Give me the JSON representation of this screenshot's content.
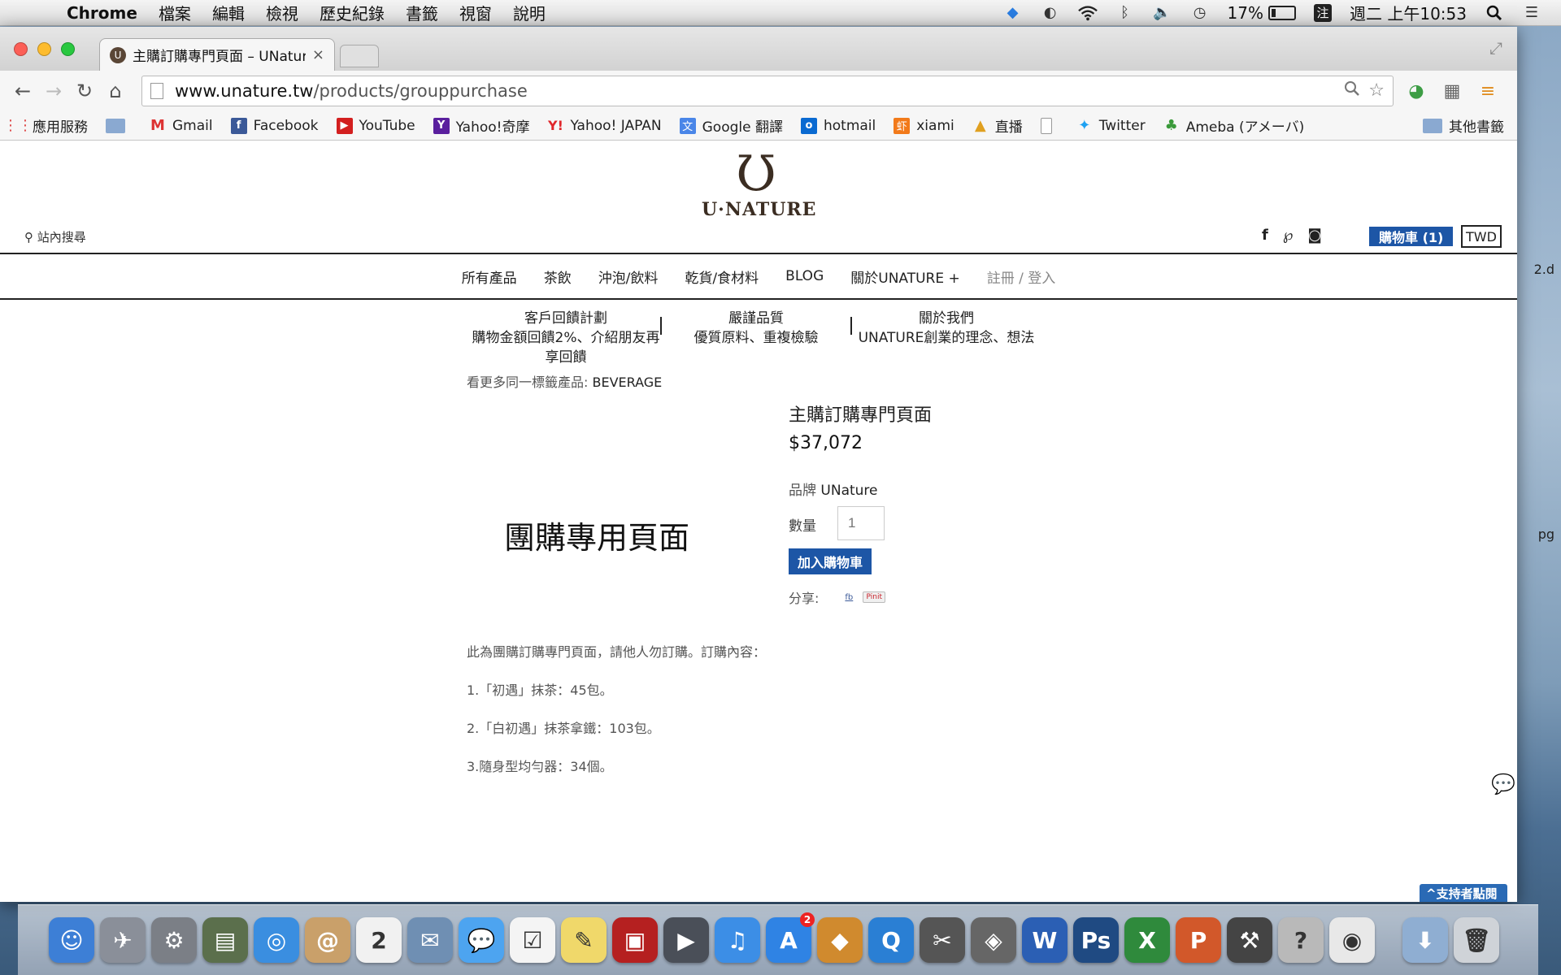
{
  "menubar": {
    "app_name": "Chrome",
    "menus": [
      "檔案",
      "編輯",
      "檢視",
      "歷史紀錄",
      "書籤",
      "視窗",
      "說明"
    ],
    "battery_percent": "17%",
    "ime": "注",
    "clock": "週二 上午10:53"
  },
  "browser": {
    "tab_title": "主購訂購專門頁面 – UNature",
    "tab_close": "×",
    "url_host": "www.unature.tw",
    "url_path": "/products/grouppurchase",
    "bookmarks": [
      {
        "label": "應用服務",
        "icon": "apps-grid-icon"
      },
      {
        "label": "",
        "icon": "folder-icon"
      },
      {
        "label": "Gmail",
        "icon": "gmail-icon"
      },
      {
        "label": "Facebook",
        "icon": "facebook-icon"
      },
      {
        "label": "YouTube",
        "icon": "youtube-icon"
      },
      {
        "label": "Yahoo!奇摩",
        "icon": "yahoo-icon"
      },
      {
        "label": "Yahoo! JAPAN",
        "icon": "yahoo-japan-icon"
      },
      {
        "label": "Google 翻譯",
        "icon": "google-translate-icon"
      },
      {
        "label": "hotmail",
        "icon": "outlook-icon"
      },
      {
        "label": "xiami",
        "icon": "xiami-icon"
      },
      {
        "label": "直播",
        "icon": "live-icon"
      },
      {
        "label": "",
        "icon": "page-icon"
      },
      {
        "label": "Twitter",
        "icon": "twitter-icon"
      },
      {
        "label": "Ameba (アメーバ)",
        "icon": "ameba-icon"
      }
    ],
    "other_bookmarks": "其他書籤"
  },
  "site": {
    "logo_text": "U·NATURE",
    "search_label": "站內搜尋",
    "cart_label": "購物車 (1)",
    "currency": "TWD",
    "nav": [
      "所有產品",
      "茶飲",
      "沖泡/飲料",
      "乾貨/食材料",
      "BLOG",
      "關於UNATURE +",
      "註冊 / 登入"
    ],
    "promos": [
      {
        "title": "客戶回饋計劃",
        "sub": "購物金額回饋2%、介紹朋友再享回饋"
      },
      {
        "title": "嚴謹品質",
        "sub": "優質原料、重複檢驗"
      },
      {
        "title": "關於我們",
        "sub": "UNATURE創業的理念、想法"
      }
    ],
    "tag_prefix": "看更多同一標籤產品:",
    "tag_value": "BEVERAGE"
  },
  "product": {
    "image_text": "團購專用頁面",
    "title": "主購訂購專門頁面",
    "price": "$37,072",
    "brand_label": "品牌",
    "brand_value": "UNature",
    "qty_label": "數量",
    "qty_value": "1",
    "add_to_cart": "加入購物車",
    "share_label": "分享:",
    "pin_label": "Pinit",
    "description": [
      "此為團購訂購專門頁面，請他人勿訂購。訂購內容：",
      "1.「初遇」抹茶：45包。",
      "2.「白初遇」抹茶拿鐵：103包。",
      "3.隨身型均勻器：34個。"
    ]
  },
  "support_label": "^支持者點閱",
  "desktop_labels": [
    "2.d",
    "pg"
  ],
  "dock_apps": [
    {
      "name": "finder",
      "color": "#3d7fd6",
      "glyph": "☺"
    },
    {
      "name": "launchpad",
      "color": "#8a8f99",
      "glyph": "✈"
    },
    {
      "name": "system-preferences",
      "color": "#7b7f86",
      "glyph": "⚙"
    },
    {
      "name": "image-capture",
      "color": "#5b6f4c",
      "glyph": "▤"
    },
    {
      "name": "safari",
      "color": "#3a8ee0",
      "glyph": "◎"
    },
    {
      "name": "contacts",
      "color": "#c9a06a",
      "glyph": "@"
    },
    {
      "name": "calendar",
      "color": "#f1f1f1",
      "glyph": "2"
    },
    {
      "name": "mail",
      "color": "#6f8fb3",
      "glyph": "✉"
    },
    {
      "name": "messages",
      "color": "#4da4f0",
      "glyph": "💬"
    },
    {
      "name": "reminders",
      "color": "#f4f4f4",
      "glyph": "☑"
    },
    {
      "name": "stickies",
      "color": "#f0d86a",
      "glyph": "✎"
    },
    {
      "name": "photo-booth",
      "color": "#b52020",
      "glyph": "▣"
    },
    {
      "name": "facetime",
      "color": "#4a4f58",
      "glyph": "▶"
    },
    {
      "name": "itunes",
      "color": "#3c8ee6",
      "glyph": "♫"
    },
    {
      "name": "app-store",
      "color": "#2f83e4",
      "glyph": "A",
      "badge": "2"
    },
    {
      "name": "keynote",
      "color": "#d08a2e",
      "glyph": "◆"
    },
    {
      "name": "quicktime",
      "color": "#2a7fd4",
      "glyph": "Q"
    },
    {
      "name": "final-cut",
      "color": "#555",
      "glyph": "✂"
    },
    {
      "name": "script-editor",
      "color": "#666",
      "glyph": "◈"
    },
    {
      "name": "word",
      "color": "#2b5fb4",
      "glyph": "W"
    },
    {
      "name": "photoshop",
      "color": "#1f4a82",
      "glyph": "Ps"
    },
    {
      "name": "excel",
      "color": "#2f8a3c",
      "glyph": "X"
    },
    {
      "name": "powerpoint",
      "color": "#d2582a",
      "glyph": "P"
    },
    {
      "name": "xcode-tools",
      "color": "#444",
      "glyph": "⚒"
    },
    {
      "name": "help",
      "color": "#b9b9b9",
      "glyph": "?"
    },
    {
      "name": "chrome",
      "color": "#e8e8e8",
      "glyph": "◉"
    },
    {
      "name": "downloads-folder",
      "color": "#8faed2",
      "glyph": "⬇"
    },
    {
      "name": "trash",
      "color": "#cfd3d8",
      "glyph": "🗑"
    }
  ]
}
